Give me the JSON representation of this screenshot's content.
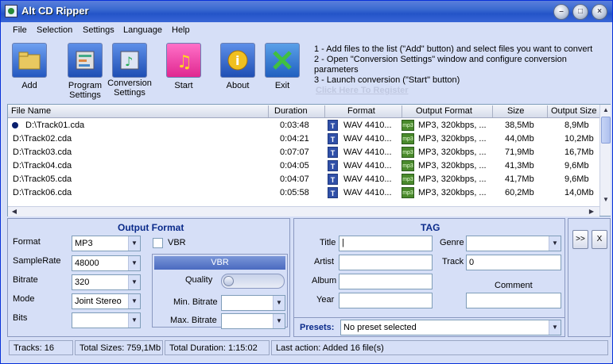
{
  "window": {
    "title": "Alt CD Ripper"
  },
  "menu": [
    "File",
    "Selection",
    "Settings",
    "Language",
    "Help"
  ],
  "toolbar": {
    "add": "Add",
    "program_settings": "Program Settings",
    "conversion_settings": "Conversion Settings",
    "start": "Start",
    "about": "About",
    "exit": "Exit"
  },
  "instructions": [
    "1 - Add files to the list (\"Add\" button) and select files you want to convert",
    "2 - Open \"Conversion Settings\" window and configure conversion parameters",
    "3 - Launch conversion (\"Start\" button)"
  ],
  "register_link": "Click Here To Register",
  "filelist": {
    "columns": [
      "File Name",
      "Duration",
      "Format",
      "Output Format",
      "Size",
      "Output Size"
    ],
    "rows": [
      {
        "name": "D:\\Track01.cda",
        "duration": "0:03:48",
        "format": "WAV 4410...",
        "output_format": "MP3, 320kbps, ...",
        "size": "38,5Mb",
        "output_size": "8,9Mb"
      },
      {
        "name": "D:\\Track02.cda",
        "duration": "0:04:21",
        "format": "WAV 4410...",
        "output_format": "MP3, 320kbps, ...",
        "size": "44,0Mb",
        "output_size": "10,2Mb"
      },
      {
        "name": "D:\\Track03.cda",
        "duration": "0:07:07",
        "format": "WAV 4410...",
        "output_format": "MP3, 320kbps, ...",
        "size": "71,9Mb",
        "output_size": "16,7Mb"
      },
      {
        "name": "D:\\Track04.cda",
        "duration": "0:04:05",
        "format": "WAV 4410...",
        "output_format": "MP3, 320kbps, ...",
        "size": "41,3Mb",
        "output_size": "9,6Mb"
      },
      {
        "name": "D:\\Track05.cda",
        "duration": "0:04:07",
        "format": "WAV 4410...",
        "output_format": "MP3, 320kbps, ...",
        "size": "41,7Mb",
        "output_size": "9,6Mb"
      },
      {
        "name": "D:\\Track06.cda",
        "duration": "0:05:58",
        "format": "WAV 4410...",
        "output_format": "MP3, 320kbps, ...",
        "size": "60,2Mb",
        "output_size": "14,0Mb"
      }
    ],
    "format_badge": "T",
    "output_badge": "mp3"
  },
  "output_format": {
    "title": "Output Format",
    "format_label": "Format",
    "format_value": "MP3",
    "samplerate_label": "SampleRate",
    "samplerate_value": "48000",
    "bitrate_label": "Bitrate",
    "bitrate_value": "320",
    "mode_label": "Mode",
    "mode_value": "Joint Stereo",
    "bits_label": "Bits",
    "bits_value": "",
    "vbr_checkbox": "VBR",
    "vbr_panel_title": "VBR",
    "quality_label": "Quality",
    "min_bitrate_label": "Min. Bitrate",
    "max_bitrate_label": "Max. Bitrate"
  },
  "tag": {
    "title": "TAG",
    "title_label": "Title",
    "artist_label": "Artist",
    "album_label": "Album",
    "year_label": "Year",
    "genre_label": "Genre",
    "track_label": "Track",
    "track_value": "0",
    "comment_label": "Comment"
  },
  "presets": {
    "label": "Presets:",
    "value": "No preset selected"
  },
  "side_buttons": {
    "expand": ">>",
    "close": "X"
  },
  "status": {
    "tracks": "Tracks: 16",
    "total_sizes": "Total Sizes: 759,1Mb",
    "total_duration": "Total Duration: 1:15:02",
    "last_action": "Last action: Added 16 file(s)"
  }
}
